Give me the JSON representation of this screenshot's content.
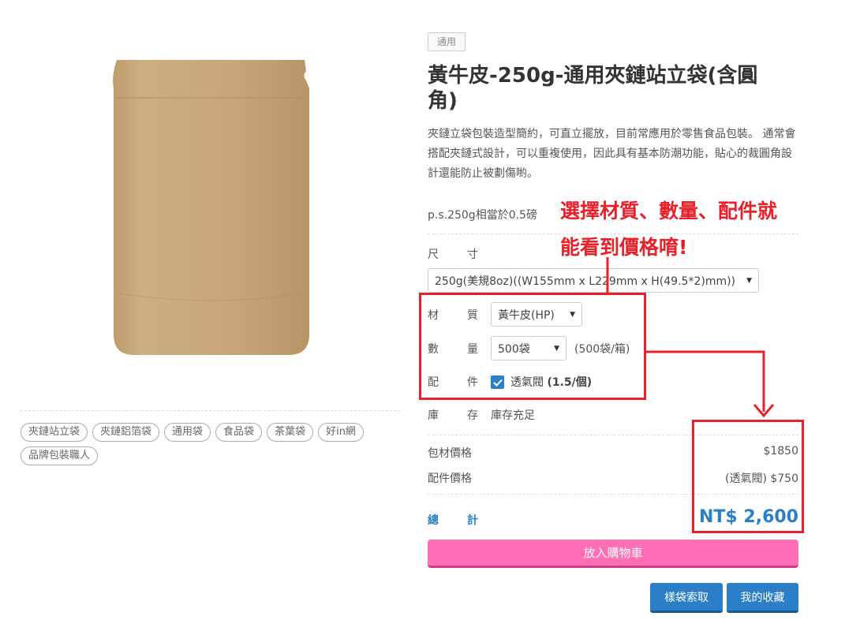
{
  "tags": [
    "夾鏈站立袋",
    "夾鏈鋁箔袋",
    "通用袋",
    "食品袋",
    "茶葉袋",
    "好in網",
    "品牌包裝職人"
  ],
  "category_badge": "通用",
  "product": {
    "title": "黃牛皮-250g-通用夾鏈站立袋(含圓角)",
    "description": "夾鏈立袋包裝造型簡約，可直立擺放，目前常應用於零售食品包裝。 通常會搭配夾鏈式設計，可以重複使用，因此具有基本防潮功能，貼心的裁圓角設計還能防止被劃傷喲。",
    "note": "p.s.250g相當於0.5磅"
  },
  "options": {
    "size": {
      "label": [
        "尺",
        "寸"
      ],
      "value": "250g(美規8oz)((W155mm x L229mm x H(49.5*2)mm))"
    },
    "material": {
      "label": [
        "材",
        "質"
      ],
      "value": "黃牛皮(HP)"
    },
    "quantity": {
      "label": [
        "數",
        "量"
      ],
      "value": "500袋",
      "unit_note": "(500袋/箱)"
    },
    "accessory": {
      "label": [
        "配",
        "件"
      ],
      "name": "透氣閥",
      "price": "(1.5/個)",
      "checked": true
    },
    "stock": {
      "label": [
        "庫",
        "存"
      ],
      "value": "庫存充足"
    }
  },
  "pricing": {
    "package_label": "包材價格",
    "package_value": "$1850",
    "accessory_label": "配件價格",
    "accessory_value": "(透氣閥) $750",
    "total_label": [
      "總",
      "計"
    ],
    "total_value": "NT$ 2,600"
  },
  "buttons": {
    "add_to_cart": "放入購物車",
    "sample": "樣袋索取",
    "favorites": "我的收藏"
  },
  "annotation": {
    "line1": "選擇材質、數量、配件就",
    "line2": "能看到價格唷!"
  },
  "colors": {
    "accent_blue": "#2a7fc8",
    "cart_pink": "#ff6fb5",
    "annotation_red": "#e8202a",
    "kraft": "#c9a87a"
  }
}
